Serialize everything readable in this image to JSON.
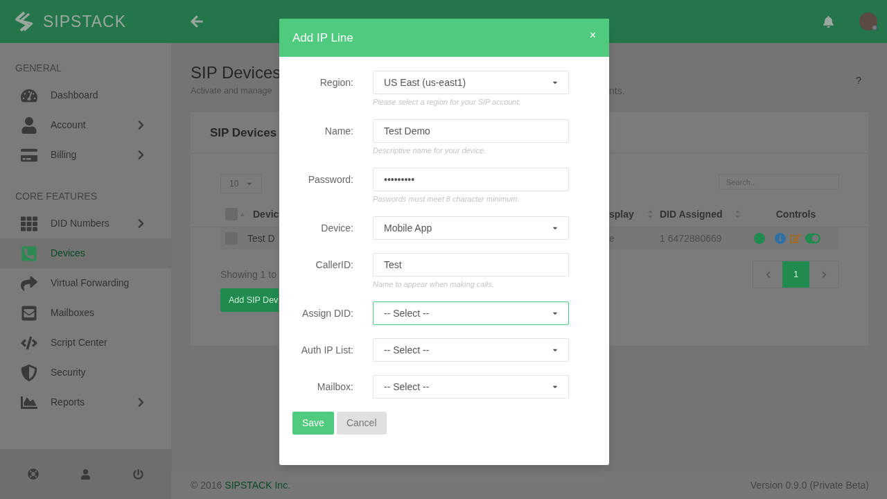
{
  "header": {
    "brand": "SIPSTACK"
  },
  "sidebar": {
    "sections": [
      {
        "title": "GENERAL",
        "items": [
          {
            "label": "Dashboard",
            "expandable": false,
            "selected": false
          },
          {
            "label": "Account",
            "expandable": true,
            "selected": false
          },
          {
            "label": "Billing",
            "expandable": true,
            "selected": false
          }
        ]
      },
      {
        "title": "CORE FEATURES",
        "items": [
          {
            "label": "DID Numbers",
            "expandable": true,
            "selected": false
          },
          {
            "label": "Devices",
            "expandable": false,
            "selected": true
          },
          {
            "label": "Virtual Forwarding",
            "expandable": false,
            "selected": false
          },
          {
            "label": "Mailboxes",
            "expandable": false,
            "selected": false
          },
          {
            "label": "Script Center",
            "expandable": false,
            "selected": false
          },
          {
            "label": "Security",
            "expandable": false,
            "selected": false
          },
          {
            "label": "Reports",
            "expandable": true,
            "selected": false
          }
        ]
      }
    ]
  },
  "page": {
    "title": "SIP Devices",
    "subtitle_start": "Activate and manage",
    "subtitle_end": "nts.",
    "help": "?"
  },
  "card": {
    "title": "SIP Devices",
    "page_size": "10",
    "all_checked": false,
    "search": {
      "placeholder": "Search.."
    },
    "columns_left": [
      "Devic"
    ],
    "columns_right": [
      "splay",
      "DID Assigned",
      "Controls"
    ],
    "rows": [
      {
        "checked": false,
        "cell_left": "Test D",
        "cell_right": "e",
        "did": "1 6472880669",
        "online": true,
        "enabled": true
      }
    ],
    "showing": "Showing 1 to",
    "add_button": "Add SIP Dev",
    "pages": [
      {
        "label": "1",
        "selected": true
      }
    ]
  },
  "footer": {
    "copyright": "© 2016",
    "company": "SIPSTACK Inc.",
    "version": "Version 0.9.0 (Private Beta)"
  },
  "modal": {
    "title": "Add IP Line",
    "close": "×",
    "fields": [
      {
        "kind": "select",
        "label": "Region:",
        "value": "US East (us-east1)",
        "hint": "Please select a region for your SIP account.",
        "focused": false
      },
      {
        "kind": "text",
        "label": "Name:",
        "value": "Test Demo",
        "hint": "Descriptive name for your device.",
        "focused": false
      },
      {
        "kind": "text",
        "label": "Password:",
        "value": "•••••••••",
        "hint": "Paswords must meet 8 character minimum.",
        "focused": false
      },
      {
        "kind": "select",
        "label": "Device:",
        "value": "Mobile App",
        "focused": false
      },
      {
        "kind": "text",
        "label": "CallerID:",
        "value": "Test",
        "hint": "Name to appear when making calls.",
        "focused": false
      },
      {
        "kind": "select",
        "label": "Assign DID:",
        "value": "-- Select --",
        "focused": true
      },
      {
        "kind": "select",
        "label": "Auth IP List:",
        "value": "-- Select --",
        "focused": false
      },
      {
        "kind": "select",
        "label": "Mailbox:",
        "value": "-- Select --",
        "focused": false
      }
    ],
    "buttons": [
      {
        "kind": "primary",
        "label": "Save"
      },
      {
        "kind": "secondary",
        "label": "Cancel"
      }
    ]
  }
}
